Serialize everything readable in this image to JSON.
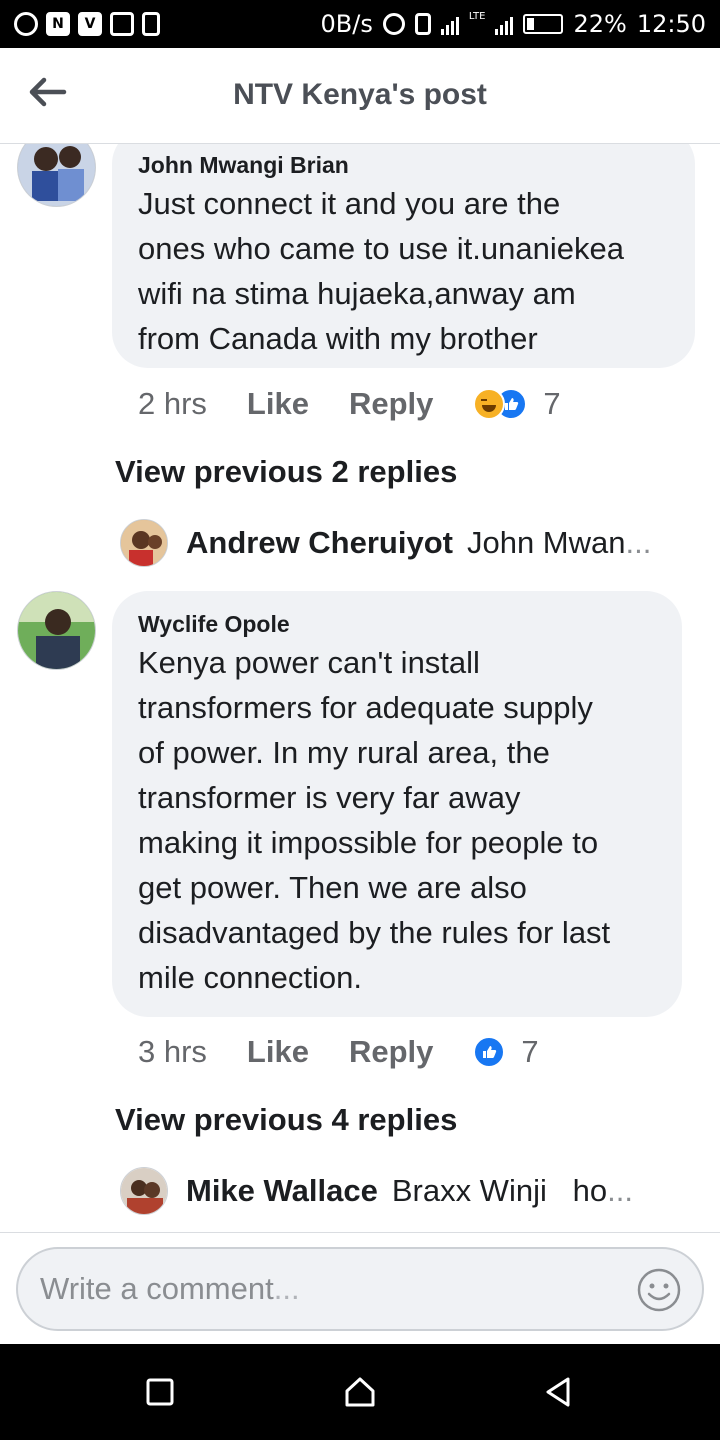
{
  "status_bar": {
    "speed": "0B/s",
    "network": "LTE",
    "battery": "22%",
    "time": "12:50"
  },
  "header": {
    "title": "NTV Kenya's post",
    "back_icon": "arrow-left-icon"
  },
  "comments": [
    {
      "author": "John Mwangi Brian",
      "lines": [
        "Just connect it and you are the",
        "ones who came to use it.unaniekea",
        "wifi na stima hujaeka,anway am",
        "from Canada with my brother"
      ],
      "time": "2 hrs",
      "like_label": "Like",
      "reply_label": "Reply",
      "reactions": [
        "haha",
        "like"
      ],
      "reaction_count": "7",
      "view_previous": "View previous 2 replies",
      "latest_reply": {
        "author": "Andrew Cheruiyot",
        "text": "John Mwan",
        "ellipsis": "..."
      }
    },
    {
      "author": "Wyclife Opole",
      "lines": [
        "Kenya power can't install",
        "transformers for adequate supply",
        "of power. In my rural area, the",
        "transformer is very far away",
        "making it impossible for people to",
        "get power. Then we are also",
        "disadvantaged by the rules for last",
        "mile connection."
      ],
      "time": "3 hrs",
      "like_label": "Like",
      "reply_label": "Reply",
      "reactions": [
        "like"
      ],
      "reaction_count": "7",
      "view_previous": "View previous 4 replies",
      "latest_reply": {
        "author": "Mike Wallace",
        "text": "Braxx Winji   ho",
        "ellipsis": "..."
      }
    }
  ],
  "composer": {
    "placeholder": "Write a comment",
    "ellipsis": "...",
    "emoji_icon": "smiley-icon"
  },
  "nav": {
    "recent": "square-icon",
    "home": "home-icon",
    "back": "triangle-back-icon"
  },
  "colors": {
    "bubble": "#f0f2f5",
    "like_blue": "#1877f2",
    "muted_text": "#65676b"
  }
}
